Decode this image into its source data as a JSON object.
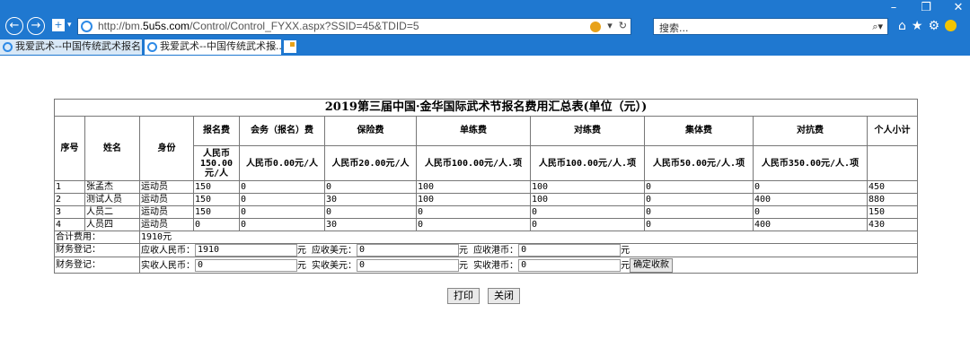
{
  "browser": {
    "url_prefix": "http://bm.",
    "url_domain": "5u5s.com",
    "url_suffix": "/Control/Control_FYXX.aspx?SSID=45&TDID=5",
    "search_placeholder": "搜索...",
    "tabs": [
      {
        "title": "我爱武术--中国传统武术报名..."
      },
      {
        "title": "我爱武术--中国传统武术报..."
      }
    ],
    "window_controls": [
      "–",
      "❐",
      "✕"
    ]
  },
  "table": {
    "title": "2019第三届中国·金华国际武术节报名费用汇总表(单位（元）)",
    "headers": {
      "seq": "序号",
      "name": "姓名",
      "identity": "身份",
      "fee_names": [
        "报名费",
        "会务（报名）费",
        "保险费",
        "单练费",
        "对练费",
        "集体费",
        "对抗费"
      ],
      "subtotal": "个人小计"
    },
    "currency_row": [
      "人民币150.00元/人",
      "人民币0.00元/人",
      "人民币20.00元/人",
      "人民币100.00元/人.项",
      "人民币100.00元/人.项",
      "人民币50.00元/人.项",
      "人民币350.00元/人.项"
    ],
    "rows": [
      {
        "seq": "1",
        "name": "张孟杰",
        "identity": "运动员",
        "fees": [
          "150",
          "0",
          "0",
          "100",
          "100",
          "0",
          "0"
        ],
        "subtotal": "450"
      },
      {
        "seq": "2",
        "name": "测试人员",
        "identity": "运动员",
        "fees": [
          "150",
          "0",
          "30",
          "100",
          "100",
          "0",
          "400"
        ],
        "subtotal": "880"
      },
      {
        "seq": "3",
        "name": "人员二",
        "identity": "运动员",
        "fees": [
          "150",
          "0",
          "0",
          "0",
          "0",
          "0",
          "0"
        ],
        "subtotal": "150"
      },
      {
        "seq": "4",
        "name": "人员四",
        "identity": "运动员",
        "fees": [
          "0",
          "0",
          "30",
          "0",
          "0",
          "0",
          "400"
        ],
        "subtotal": "430"
      }
    ],
    "total_label": "合计费用：",
    "total_value": "1910元",
    "receivable": {
      "label": "财务登记：",
      "rmb_label": "应收人民币：",
      "rmb_value": "1910",
      "yuan": "元",
      "usd_label": "应收美元：",
      "usd_value": "0",
      "hkd_label": "应收港币：",
      "hkd_value": "0"
    },
    "received": {
      "label": "财务登记：",
      "rmb_label": "实收人民币：",
      "rmb_value": "0",
      "yuan": "元",
      "usd_label": "实收美元：",
      "usd_value": "0",
      "hkd_label": "实收港币：",
      "hkd_value": "0",
      "confirm_button": "确定收款"
    }
  },
  "actions": {
    "print": "打印",
    "close": "关闭"
  }
}
